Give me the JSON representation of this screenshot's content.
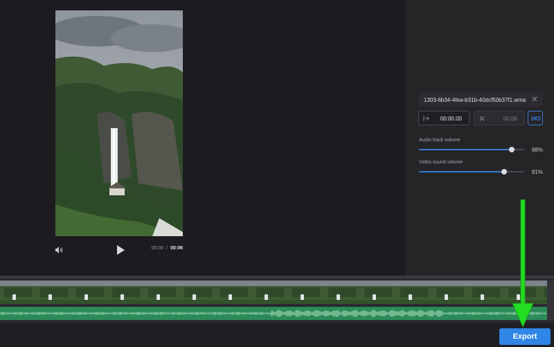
{
  "player": {
    "current_time": "00:00",
    "separator": "/",
    "total_time": "00:06",
    "volume_icon": "speaker-icon",
    "play_icon": "play-icon"
  },
  "audio_panel": {
    "filename": "1303-6b34-4fea-b31b-40dcf50b37f1.wma",
    "start_time": "00:00.00",
    "end_time": "00:06",
    "audio_track_volume_label": "Audio track volume",
    "audio_track_volume": "88%",
    "audio_track_volume_value": 0.88,
    "video_sound_volume_label": "Video sound volume",
    "video_sound_volume": "81%",
    "video_sound_volume_value": 0.81
  },
  "export": {
    "label": "Export"
  },
  "colors": {
    "accent": "#2f86e6",
    "audio_track": "#2b8a58",
    "annotation_arrow": "#22dd22"
  }
}
